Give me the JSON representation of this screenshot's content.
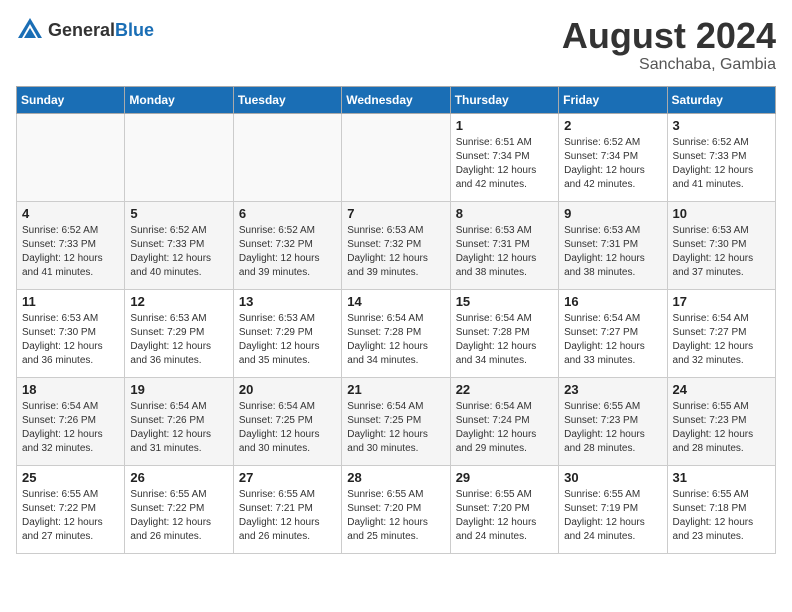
{
  "header": {
    "logo_general": "General",
    "logo_blue": "Blue",
    "title": "August 2024",
    "location": "Sanchaba, Gambia"
  },
  "days_of_week": [
    "Sunday",
    "Monday",
    "Tuesday",
    "Wednesday",
    "Thursday",
    "Friday",
    "Saturday"
  ],
  "weeks": [
    [
      {
        "day": "",
        "info": ""
      },
      {
        "day": "",
        "info": ""
      },
      {
        "day": "",
        "info": ""
      },
      {
        "day": "",
        "info": ""
      },
      {
        "day": "1",
        "info": "Sunrise: 6:51 AM\nSunset: 7:34 PM\nDaylight: 12 hours\nand 42 minutes."
      },
      {
        "day": "2",
        "info": "Sunrise: 6:52 AM\nSunset: 7:34 PM\nDaylight: 12 hours\nand 42 minutes."
      },
      {
        "day": "3",
        "info": "Sunrise: 6:52 AM\nSunset: 7:33 PM\nDaylight: 12 hours\nand 41 minutes."
      }
    ],
    [
      {
        "day": "4",
        "info": "Sunrise: 6:52 AM\nSunset: 7:33 PM\nDaylight: 12 hours\nand 41 minutes."
      },
      {
        "day": "5",
        "info": "Sunrise: 6:52 AM\nSunset: 7:33 PM\nDaylight: 12 hours\nand 40 minutes."
      },
      {
        "day": "6",
        "info": "Sunrise: 6:52 AM\nSunset: 7:32 PM\nDaylight: 12 hours\nand 39 minutes."
      },
      {
        "day": "7",
        "info": "Sunrise: 6:53 AM\nSunset: 7:32 PM\nDaylight: 12 hours\nand 39 minutes."
      },
      {
        "day": "8",
        "info": "Sunrise: 6:53 AM\nSunset: 7:31 PM\nDaylight: 12 hours\nand 38 minutes."
      },
      {
        "day": "9",
        "info": "Sunrise: 6:53 AM\nSunset: 7:31 PM\nDaylight: 12 hours\nand 38 minutes."
      },
      {
        "day": "10",
        "info": "Sunrise: 6:53 AM\nSunset: 7:30 PM\nDaylight: 12 hours\nand 37 minutes."
      }
    ],
    [
      {
        "day": "11",
        "info": "Sunrise: 6:53 AM\nSunset: 7:30 PM\nDaylight: 12 hours\nand 36 minutes."
      },
      {
        "day": "12",
        "info": "Sunrise: 6:53 AM\nSunset: 7:29 PM\nDaylight: 12 hours\nand 36 minutes."
      },
      {
        "day": "13",
        "info": "Sunrise: 6:53 AM\nSunset: 7:29 PM\nDaylight: 12 hours\nand 35 minutes."
      },
      {
        "day": "14",
        "info": "Sunrise: 6:54 AM\nSunset: 7:28 PM\nDaylight: 12 hours\nand 34 minutes."
      },
      {
        "day": "15",
        "info": "Sunrise: 6:54 AM\nSunset: 7:28 PM\nDaylight: 12 hours\nand 34 minutes."
      },
      {
        "day": "16",
        "info": "Sunrise: 6:54 AM\nSunset: 7:27 PM\nDaylight: 12 hours\nand 33 minutes."
      },
      {
        "day": "17",
        "info": "Sunrise: 6:54 AM\nSunset: 7:27 PM\nDaylight: 12 hours\nand 32 minutes."
      }
    ],
    [
      {
        "day": "18",
        "info": "Sunrise: 6:54 AM\nSunset: 7:26 PM\nDaylight: 12 hours\nand 32 minutes."
      },
      {
        "day": "19",
        "info": "Sunrise: 6:54 AM\nSunset: 7:26 PM\nDaylight: 12 hours\nand 31 minutes."
      },
      {
        "day": "20",
        "info": "Sunrise: 6:54 AM\nSunset: 7:25 PM\nDaylight: 12 hours\nand 30 minutes."
      },
      {
        "day": "21",
        "info": "Sunrise: 6:54 AM\nSunset: 7:25 PM\nDaylight: 12 hours\nand 30 minutes."
      },
      {
        "day": "22",
        "info": "Sunrise: 6:54 AM\nSunset: 7:24 PM\nDaylight: 12 hours\nand 29 minutes."
      },
      {
        "day": "23",
        "info": "Sunrise: 6:55 AM\nSunset: 7:23 PM\nDaylight: 12 hours\nand 28 minutes."
      },
      {
        "day": "24",
        "info": "Sunrise: 6:55 AM\nSunset: 7:23 PM\nDaylight: 12 hours\nand 28 minutes."
      }
    ],
    [
      {
        "day": "25",
        "info": "Sunrise: 6:55 AM\nSunset: 7:22 PM\nDaylight: 12 hours\nand 27 minutes."
      },
      {
        "day": "26",
        "info": "Sunrise: 6:55 AM\nSunset: 7:22 PM\nDaylight: 12 hours\nand 26 minutes."
      },
      {
        "day": "27",
        "info": "Sunrise: 6:55 AM\nSunset: 7:21 PM\nDaylight: 12 hours\nand 26 minutes."
      },
      {
        "day": "28",
        "info": "Sunrise: 6:55 AM\nSunset: 7:20 PM\nDaylight: 12 hours\nand 25 minutes."
      },
      {
        "day": "29",
        "info": "Sunrise: 6:55 AM\nSunset: 7:20 PM\nDaylight: 12 hours\nand 24 minutes."
      },
      {
        "day": "30",
        "info": "Sunrise: 6:55 AM\nSunset: 7:19 PM\nDaylight: 12 hours\nand 24 minutes."
      },
      {
        "day": "31",
        "info": "Sunrise: 6:55 AM\nSunset: 7:18 PM\nDaylight: 12 hours\nand 23 minutes."
      }
    ]
  ]
}
